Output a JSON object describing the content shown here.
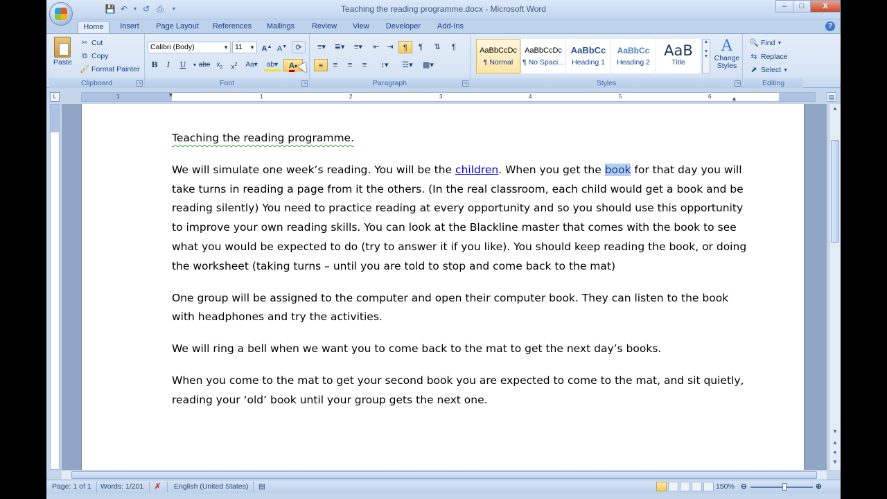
{
  "window": {
    "title": "Teaching the reading programme.docx - Microsoft Word",
    "minimize": "–",
    "maximize": "□",
    "close": "X"
  },
  "tabs": [
    "Home",
    "Insert",
    "Page Layout",
    "References",
    "Mailings",
    "Review",
    "View",
    "Developer",
    "Add-Ins"
  ],
  "ribbon": {
    "clipboard": {
      "label": "Clipboard",
      "paste": "Paste",
      "cut": "Cut",
      "copy": "Copy",
      "format_painter": "Format Painter"
    },
    "font": {
      "label": "Font",
      "font_name": "Calibri (Body)",
      "font_size": "11"
    },
    "paragraph": {
      "label": "Paragraph"
    },
    "styles": {
      "label": "Styles",
      "items": [
        {
          "sample": "AaBbCcDc",
          "name": "¶ Normal"
        },
        {
          "sample": "AaBbCcDc",
          "name": "¶ No Spaci..."
        },
        {
          "sample": "AaBbCc",
          "name": "Heading 1"
        },
        {
          "sample": "AaBbCc",
          "name": "Heading 2"
        },
        {
          "sample": "AaB",
          "name": "Title"
        }
      ],
      "change_styles": "Change Styles"
    },
    "editing": {
      "label": "Editing",
      "find": "Find",
      "replace": "Replace",
      "select": "Select"
    }
  },
  "ruler": {
    "numbers": [
      "1",
      "1",
      "2",
      "3",
      "4",
      "5",
      "6"
    ]
  },
  "document": {
    "heading": "Teaching the reading programme.",
    "p1_before_link": "We will simulate one week’s reading. You will be the ",
    "p1_link": "children",
    "p1_mid": ". When you get the ",
    "p1_selected": "book",
    "p1_after": " for that day you will take turns in reading a page from it the others. (In the real classroom, each child would get a book and be reading silently) You need to practice reading at every opportunity and so you should use this opportunity to improve your own reading skills. You can look at the Blackline master that comes with the book to see what you would be expected to do (try to answer it if you like). You should keep reading the book, or doing the worksheet (taking turns – until you are told to stop and come back to the mat)",
    "p2": "One group will be assigned to the computer and open their computer book. They can listen to the book with headphones and try the activities.",
    "p3": "We will ring a bell when we want you to come back to the mat to get the next day’s books.",
    "p4": "When you come to the mat to get your second book you are expected to come to the mat, and sit quietly, reading your ‘old’ book until your group gets the next one."
  },
  "status": {
    "page": "Page: 1 of 1",
    "words": "Words: 1/201",
    "language": "English (United States)",
    "zoom": "150%"
  }
}
